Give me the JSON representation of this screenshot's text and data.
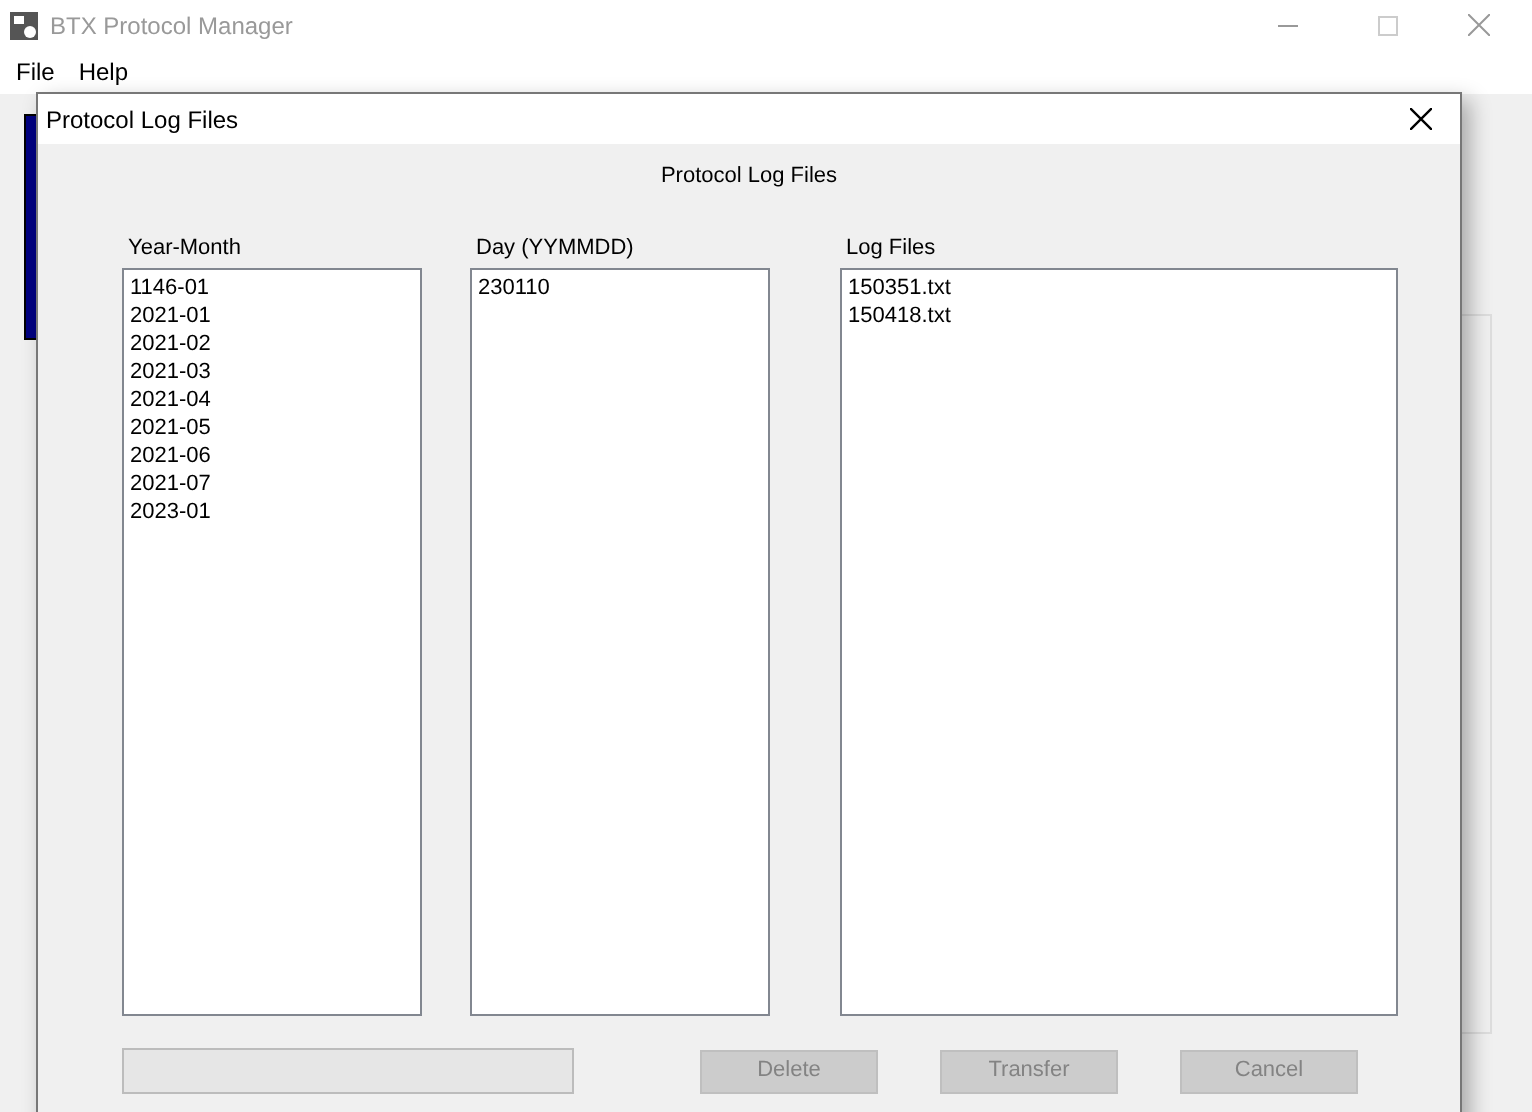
{
  "window": {
    "title": "BTX Protocol Manager",
    "active": false
  },
  "menu": [
    "File",
    "Help"
  ],
  "dialog": {
    "title": "Protocol Log Files",
    "heading": "Protocol Log Files",
    "lists": [
      {
        "label": "Year-Month",
        "items": [
          "1146-01",
          "2021-01",
          "2021-02",
          "2021-03",
          "2021-04",
          "2021-05",
          "2021-06",
          "2021-07",
          "2023-01"
        ]
      },
      {
        "label": "Day (YYMMDD)",
        "items": [
          "230110"
        ]
      },
      {
        "label": "Log Files",
        "items": [
          "150351.txt",
          "150418.txt"
        ]
      }
    ],
    "progress": {
      "level": 0
    },
    "buttons": [
      {
        "label": "Delete",
        "disabled": true
      },
      {
        "label": "Transfer",
        "disabled": true
      },
      {
        "label": "Cancel",
        "disabled": true
      }
    ]
  }
}
